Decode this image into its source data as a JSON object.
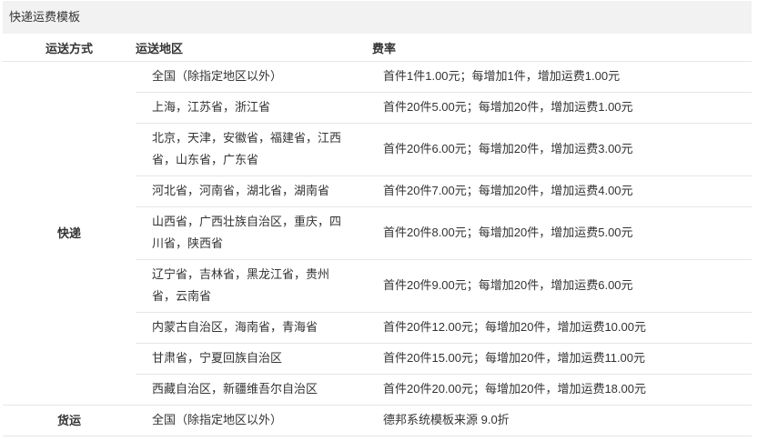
{
  "colors": {
    "title_bg": "#f2f2f2",
    "border": "#e6e6e6",
    "text": "#333333"
  },
  "template": {
    "title": "快递运费模板",
    "columns": {
      "method": "运送方式",
      "region": "运送地区",
      "rate": "费率"
    },
    "groups": [
      {
        "method": "快递",
        "rows": [
          {
            "region": "全国（除指定地区以外）",
            "rate": "首件1件1.00元；每增加1件，增加运费1.00元"
          },
          {
            "region": "上海，江苏省，浙江省",
            "rate": "首件20件5.00元；每增加20件，增加运费1.00元"
          },
          {
            "region": "北京，天津，安徽省，福建省，江西省，山东省，广东省",
            "rate": "首件20件6.00元；每增加20件，增加运费3.00元"
          },
          {
            "region": "河北省，河南省，湖北省，湖南省",
            "rate": "首件20件7.00元；每增加20件，增加运费4.00元"
          },
          {
            "region": "山西省，广西壮族自治区，重庆，四川省，陕西省",
            "rate": "首件20件8.00元；每增加20件，增加运费5.00元"
          },
          {
            "region": "辽宁省，吉林省，黑龙江省，贵州省，云南省",
            "rate": "首件20件9.00元；每增加20件，增加运费6.00元"
          },
          {
            "region": "内蒙古自治区，海南省，青海省",
            "rate": "首件20件12.00元；每增加20件，增加运费10.00元"
          },
          {
            "region": "甘肃省，宁夏回族自治区",
            "rate": "首件20件15.00元；每增加20件，增加运费11.00元"
          },
          {
            "region": "西藏自治区，新疆维吾尔自治区",
            "rate": "首件20件20.00元；每增加20件，增加运费18.00元"
          }
        ]
      },
      {
        "method": "货运",
        "rows": [
          {
            "region": "全国（除指定地区以外）",
            "rate": "德邦系统模板来源 9.0折"
          }
        ]
      }
    ]
  }
}
